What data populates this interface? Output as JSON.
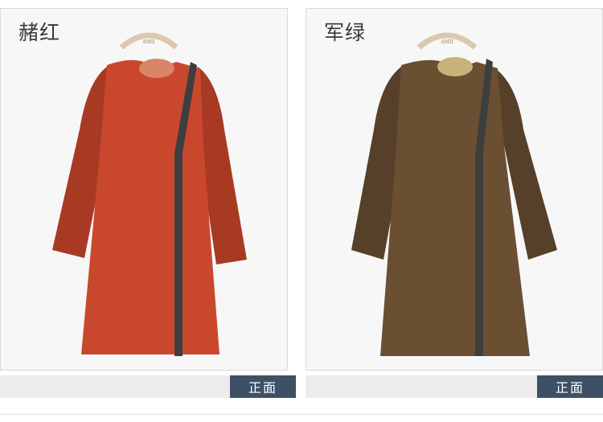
{
  "products": [
    {
      "color_name": "赭红",
      "view_label": "正面",
      "body_color": "#c9482d",
      "shadow_color": "#a83a23",
      "hanger_label": "AMII"
    },
    {
      "color_name": "军绿",
      "view_label": "正面",
      "body_color": "#6b4f33",
      "shadow_color": "#57402a",
      "hanger_label": "AMII"
    }
  ],
  "trim_color": "#3e3e40"
}
